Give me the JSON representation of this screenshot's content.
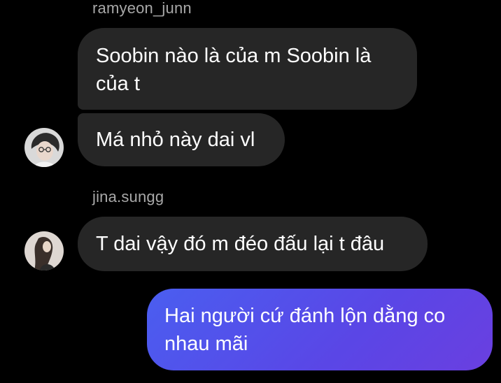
{
  "conversation": {
    "groups": [
      {
        "sender": "ramyeon_junn",
        "messages": [
          "Soobin nào là của m Soobin là của t",
          "Má nhỏ này dai vl"
        ],
        "avatar": "avatar-ramyeon-junn"
      },
      {
        "sender": "jina.sungg",
        "messages": [
          "T dai vậy đó m đéo đấu lại t đâu"
        ],
        "avatar": "avatar-jina-sungg"
      }
    ],
    "outgoing": [
      "Hai người cứ đánh lộn dằng co nhau mãi"
    ]
  },
  "colors": {
    "background": "#000000",
    "incoming_bubble": "#262626",
    "outgoing_bubble_start": "#4a5ef0",
    "outgoing_bubble_end": "#6a3fe0",
    "sender_text": "#a8a8a8",
    "message_text": "#ffffff"
  }
}
